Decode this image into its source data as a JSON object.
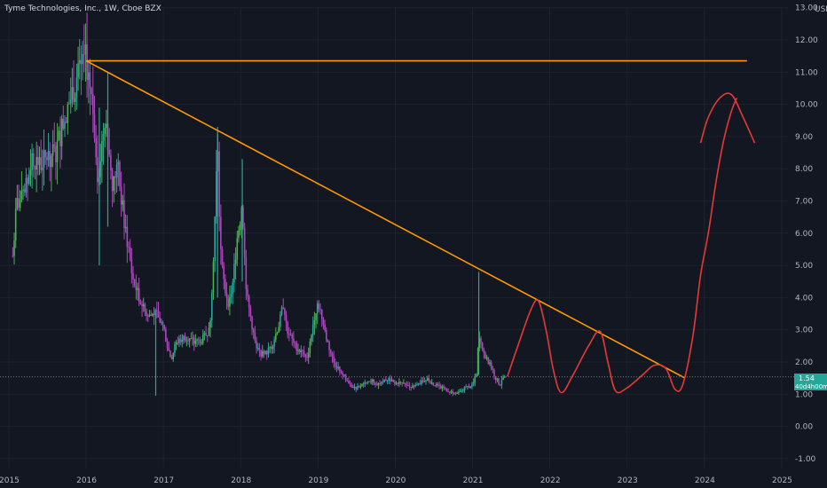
{
  "header": {
    "title": "Tyme Technologies, Inc., 1W, Cboe BZX",
    "currency": "USD"
  },
  "price_badges": {
    "last_price": "1.54",
    "countdown": "40d4h00m"
  },
  "colors": {
    "background": "#131722",
    "candle_up": "#26a69a",
    "candle_up_alt": "#4caf50",
    "candle_down": "#ab47bc",
    "trendline": "#ff9800",
    "projection": "#e53935",
    "grid": "#1e222d",
    "badge": "#26a69a"
  },
  "chart_data": {
    "type": "candlestick",
    "title": "Tyme Technologies, Inc., 1W, Cboe BZX",
    "x_ticks": [
      "2015",
      "2016",
      "2017",
      "2018",
      "2019",
      "2020",
      "2021",
      "2022",
      "2023",
      "2024",
      "2025"
    ],
    "y_ticks": [
      "13.00",
      "12.00",
      "11.00",
      "10.00",
      "9.00",
      "8.00",
      "7.00",
      "6.00",
      "5.00",
      "4.00",
      "3.00",
      "2.00",
      "1.00",
      "0.00",
      "-1.00"
    ],
    "xlim": [
      2015.0,
      2025.5
    ],
    "ylim": [
      -1.2,
      13.1
    ],
    "price_path": [
      [
        2015.05,
        5.3
      ],
      [
        2015.1,
        6.9
      ],
      [
        2015.2,
        7.1
      ],
      [
        2015.3,
        8.4
      ],
      [
        2015.4,
        8.1
      ],
      [
        2015.5,
        8.4
      ],
      [
        2015.6,
        8.5
      ],
      [
        2015.7,
        9.4
      ],
      [
        2015.8,
        10.2
      ],
      [
        2015.9,
        10.9
      ],
      [
        2016.0,
        11.4
      ],
      [
        2016.05,
        10.5
      ],
      [
        2016.1,
        9.5
      ],
      [
        2016.15,
        7.8
      ],
      [
        2016.2,
        8.7
      ],
      [
        2016.25,
        9.8
      ],
      [
        2016.3,
        8.4
      ],
      [
        2016.35,
        7.4
      ],
      [
        2016.4,
        8.2
      ],
      [
        2016.45,
        7.2
      ],
      [
        2016.5,
        6.2
      ],
      [
        2016.55,
        5.5
      ],
      [
        2016.6,
        4.6
      ],
      [
        2016.7,
        3.9
      ],
      [
        2016.8,
        3.4
      ],
      [
        2016.9,
        3.5
      ],
      [
        2017.0,
        3.1
      ],
      [
        2017.05,
        2.5
      ],
      [
        2017.1,
        2.1
      ],
      [
        2017.15,
        2.5
      ],
      [
        2017.2,
        2.7
      ],
      [
        2017.3,
        2.8
      ],
      [
        2017.4,
        2.6
      ],
      [
        2017.5,
        2.7
      ],
      [
        2017.6,
        3.0
      ],
      [
        2017.65,
        5.5
      ],
      [
        2017.7,
        8.8
      ],
      [
        2017.72,
        6.8
      ],
      [
        2017.75,
        5.0
      ],
      [
        2017.8,
        4.2
      ],
      [
        2017.85,
        3.8
      ],
      [
        2017.9,
        4.5
      ],
      [
        2017.95,
        5.8
      ],
      [
        2018.0,
        6.6
      ],
      [
        2018.02,
        7.1
      ],
      [
        2018.05,
        5.2
      ],
      [
        2018.08,
        4.0
      ],
      [
        2018.12,
        3.5
      ],
      [
        2018.2,
        2.4
      ],
      [
        2018.3,
        2.2
      ],
      [
        2018.4,
        2.5
      ],
      [
        2018.5,
        3.2
      ],
      [
        2018.55,
        3.8
      ],
      [
        2018.6,
        3.0
      ],
      [
        2018.7,
        2.5
      ],
      [
        2018.8,
        2.3
      ],
      [
        2018.85,
        2.1
      ],
      [
        2018.9,
        2.6
      ],
      [
        2018.95,
        3.4
      ],
      [
        2019.0,
        3.9
      ],
      [
        2019.05,
        3.4
      ],
      [
        2019.1,
        2.8
      ],
      [
        2019.15,
        2.4
      ],
      [
        2019.2,
        2.0
      ],
      [
        2019.3,
        1.7
      ],
      [
        2019.35,
        1.5
      ],
      [
        2019.4,
        1.3
      ],
      [
        2019.5,
        1.2
      ],
      [
        2019.6,
        1.3
      ],
      [
        2019.7,
        1.4
      ],
      [
        2019.8,
        1.3
      ],
      [
        2019.9,
        1.5
      ],
      [
        2020.0,
        1.3
      ],
      [
        2020.1,
        1.4
      ],
      [
        2020.2,
        1.2
      ],
      [
        2020.3,
        1.3
      ],
      [
        2020.4,
        1.5
      ],
      [
        2020.5,
        1.3
      ],
      [
        2020.6,
        1.2
      ],
      [
        2020.7,
        1.1
      ],
      [
        2020.8,
        1.0
      ],
      [
        2020.9,
        1.2
      ],
      [
        2021.0,
        1.3
      ],
      [
        2021.05,
        1.6
      ],
      [
        2021.08,
        2.8
      ],
      [
        2021.12,
        2.4
      ],
      [
        2021.2,
        2.0
      ],
      [
        2021.25,
        1.8
      ],
      [
        2021.3,
        1.5
      ],
      [
        2021.35,
        1.3
      ],
      [
        2021.42,
        1.54
      ]
    ],
    "spikes": [
      {
        "x": 2016.9,
        "high": 3.6,
        "low": 0.95
      },
      {
        "x": 2017.7,
        "high": 9.3,
        "low": 4.0
      },
      {
        "x": 2018.02,
        "high": 8.3,
        "low": 4.5
      },
      {
        "x": 2021.08,
        "high": 4.8,
        "low": 1.6
      },
      {
        "x": 2016.17,
        "high": 9.9,
        "low": 5.0
      },
      {
        "x": 2016.28,
        "high": 11.0,
        "low": 6.2
      }
    ],
    "horizontal_line": {
      "x1": 2016.0,
      "x2": 2024.55,
      "y": 11.35
    },
    "trendline": [
      [
        2016.0,
        11.35
      ],
      [
        2023.75,
        1.5
      ]
    ],
    "projection": [
      [
        2021.45,
        1.55
      ],
      [
        2021.6,
        2.6
      ],
      [
        2021.75,
        3.6
      ],
      [
        2021.85,
        3.9
      ],
      [
        2021.95,
        3.0
      ],
      [
        2022.05,
        1.7
      ],
      [
        2022.15,
        1.05
      ],
      [
        2022.3,
        1.6
      ],
      [
        2022.5,
        2.5
      ],
      [
        2022.65,
        2.95
      ],
      [
        2022.75,
        2.0
      ],
      [
        2022.85,
        1.1
      ],
      [
        2023.0,
        1.2
      ],
      [
        2023.2,
        1.6
      ],
      [
        2023.35,
        1.9
      ],
      [
        2023.5,
        1.8
      ],
      [
        2023.62,
        1.15
      ],
      [
        2023.72,
        1.3
      ],
      [
        2023.85,
        2.8
      ],
      [
        2023.95,
        4.7
      ],
      [
        2024.05,
        6.0
      ],
      [
        2024.15,
        7.6
      ],
      [
        2024.25,
        8.9
      ],
      [
        2024.35,
        9.8
      ],
      [
        2024.42,
        10.2
      ]
    ],
    "projection_top": [
      [
        2023.95,
        8.8
      ],
      [
        2024.05,
        9.6
      ],
      [
        2024.2,
        10.2
      ],
      [
        2024.35,
        10.3
      ],
      [
        2024.5,
        9.6
      ],
      [
        2024.65,
        8.8
      ]
    ]
  }
}
